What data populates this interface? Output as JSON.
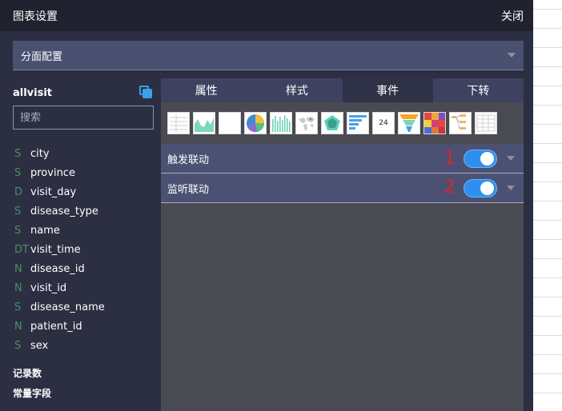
{
  "dialog": {
    "title": "图表设置",
    "close_label": "关闭"
  },
  "facet": {
    "label": "分面配置"
  },
  "datasource": {
    "name": "allvisit"
  },
  "search": {
    "placeholder": "搜索"
  },
  "fields": [
    {
      "type": "S",
      "name": "city"
    },
    {
      "type": "S",
      "name": "province"
    },
    {
      "type": "D",
      "name": "visit_day"
    },
    {
      "type": "S",
      "name": "disease_type"
    },
    {
      "type": "S",
      "name": "name"
    },
    {
      "type": "DT",
      "name": "visit_time"
    },
    {
      "type": "N",
      "name": "disease_id"
    },
    {
      "type": "N",
      "name": "visit_id"
    },
    {
      "type": "S",
      "name": "disease_name"
    },
    {
      "type": "N",
      "name": "patient_id"
    },
    {
      "type": "S",
      "name": "sex"
    }
  ],
  "extras": {
    "records": "记录数",
    "constants": "常量字段"
  },
  "tabs": [
    {
      "label": "属性"
    },
    {
      "label": "样式"
    },
    {
      "label": "事件"
    },
    {
      "label": "下转"
    }
  ],
  "chart_thumbnails": [
    "grid-table-icon",
    "area-chart-icon",
    "blank-chart-icon",
    "pie-chart-icon",
    "bar-chart-icon",
    "map-chart-icon",
    "radar-chart-icon",
    "horizontal-bar-icon",
    "kpi-number-icon",
    "funnel-chart-icon",
    "heatmap-icon",
    "tree-chart-icon",
    "pivot-table-icon"
  ],
  "kpi_number": "24",
  "events": [
    {
      "label": "触发联动",
      "marker": "1",
      "enabled": true
    },
    {
      "label": "监听联动",
      "marker": "2",
      "enabled": true
    }
  ],
  "colors": {
    "toggle_on": "#2f8fef",
    "marker_red": "#e02424",
    "field_type": "#4a8f62",
    "accent": "#3aa0e8"
  }
}
